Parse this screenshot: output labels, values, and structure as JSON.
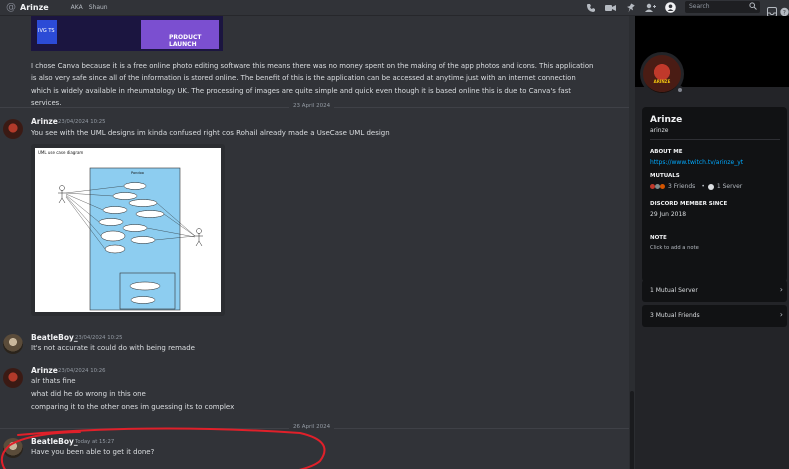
{
  "header": {
    "channel_title": "Arinze",
    "aka_label": "AKA",
    "aka_name": "Shaun",
    "search_placeholder": "Search",
    "icons": [
      "phone-icon",
      "video-icon",
      "pin-icon",
      "add-friend-icon",
      "profile-icon",
      "search-icon",
      "inbox-icon",
      "help-icon"
    ]
  },
  "top_image": {
    "left_text": "IVG TS",
    "right_text": "PRODUCT LAUNCH"
  },
  "top_paragraph": "I chose Canva because it is a free online photo editing software this means there was no money spent on the making of the app photos and icons. This application is also very safe since all of the information is stored online. The benefit of this is the application can be accessed at anytime just with an internet connection which is widely available in rheumatology UK. The processing of images are quite simple and quick even though it is based online this is due to Canva's fast services.",
  "dividers": {
    "first": "23 April 2024",
    "second": "26 April 2024"
  },
  "messages": [
    {
      "author": "Arinze",
      "timestamp": "23/04/2024 10:25",
      "lines": [
        "You see with the UML designs im kinda confused right cos Rohail already made a UseCase UML design"
      ]
    },
    {
      "author": "BeatleBoy_",
      "timestamp": "23/04/2024 10:25",
      "lines": [
        "It's not accurate it could do with being remade"
      ]
    },
    {
      "author": "Arinze",
      "timestamp": "23/04/2024 10:26",
      "lines": [
        "alr thats fine",
        "what did he do wrong in this one",
        "comparing it to the other ones im guessing its to complex"
      ]
    },
    {
      "author": "BeatleBoy_",
      "timestamp": "Today at 15:27",
      "lines": [
        "Have you been able to get it done?"
      ]
    }
  ],
  "uml_image": {
    "title": "UML use case diagram",
    "system_label": "Pondoo",
    "actor_left": "Actor",
    "actor_right": "Admin"
  },
  "profile": {
    "display_name": "Arinze",
    "username": "arinze",
    "about_heading": "ABOUT ME",
    "about_link": "https://www.twitch.tv/arinze_yt",
    "mutuals_heading": "MUTUALS",
    "mutual_friends": "3 Friends",
    "mutual_servers": "1 Server",
    "member_since_heading": "DISCORD MEMBER SINCE",
    "member_since": "29 Jun 2018",
    "note_heading": "NOTE",
    "note_placeholder": "Click to add a note",
    "mutual_server_row": "1 Mutual Server",
    "mutual_friends_row": "3 Mutual Friends",
    "avatar_text": "ARINZE"
  },
  "colors": {
    "background": "#313338",
    "panel": "#232428",
    "link": "#00a8fc",
    "annotation_red": "#e0202a",
    "uml_system_fill": "#8dcdf0"
  }
}
